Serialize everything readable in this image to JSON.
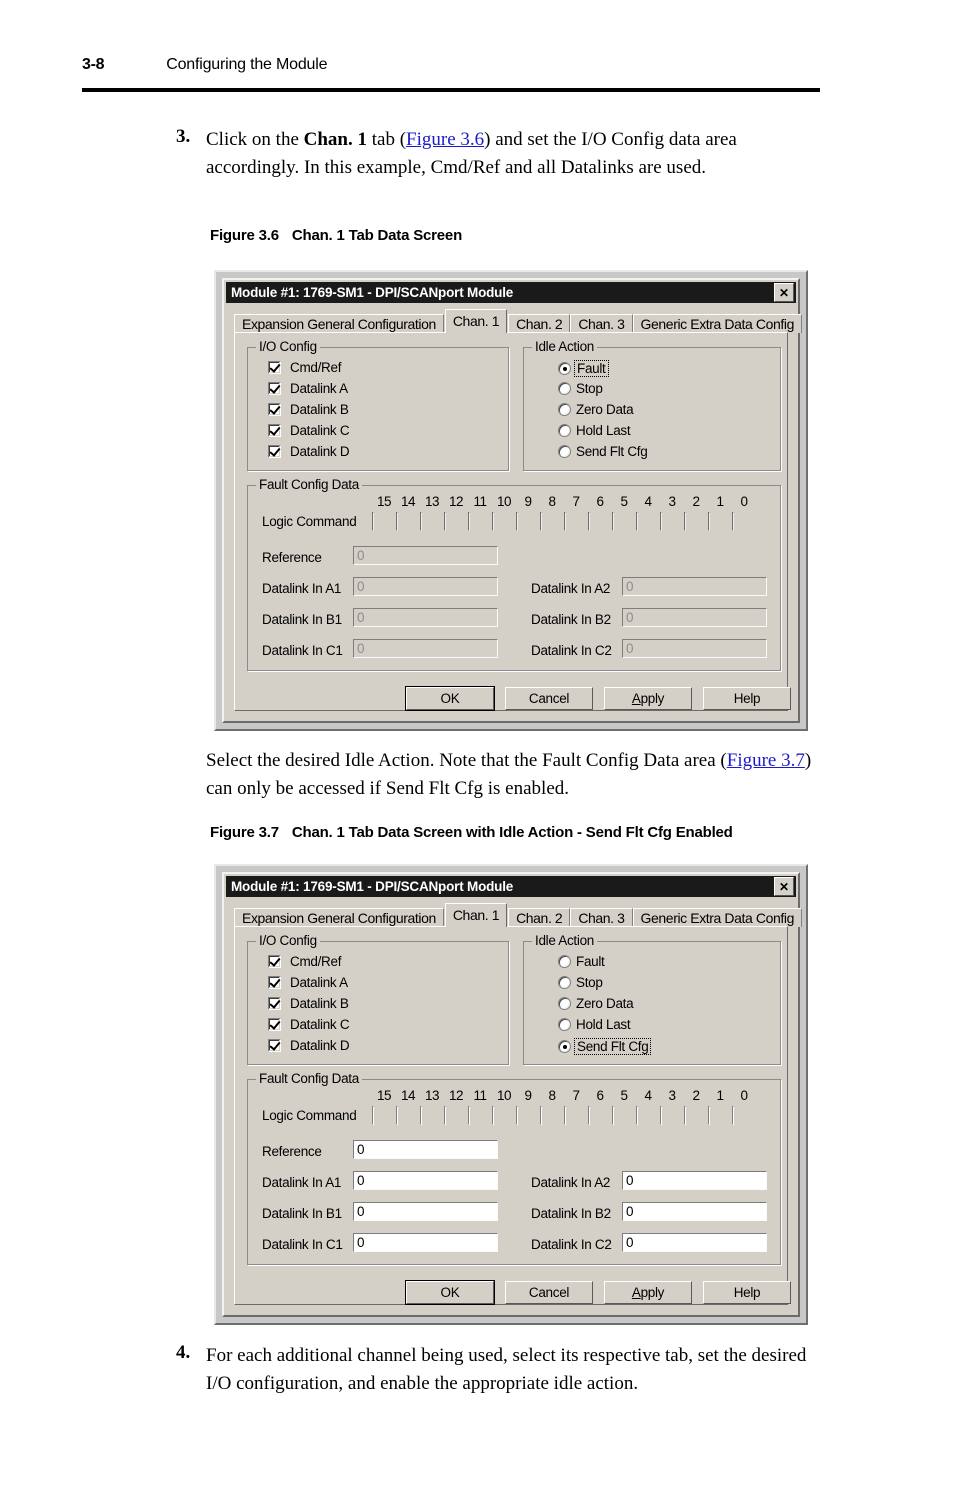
{
  "page": {
    "number": "3-8",
    "running_head": "Configuring the Module"
  },
  "step3": {
    "num": "3.",
    "text_a": "Click on the ",
    "bold_a": "Chan. 1",
    "text_b": " tab (",
    "link": "Figure 3.6",
    "text_c": ") and set the I/O Config data area accordingly. In this example, Cmd/Ref and all Datalinks are used."
  },
  "figure36": {
    "label": "Figure 3.6",
    "caption": "Chan. 1 Tab Data Screen"
  },
  "midpara": {
    "text_a": "Select the desired Idle Action. Note that the Fault Config Data area (",
    "link": "Figure 3.7",
    "text_b": ") can only be accessed if Send Flt Cfg is enabled."
  },
  "figure37": {
    "label": "Figure 3.7",
    "caption": "Chan. 1 Tab Data Screen with Idle Action - Send Flt Cfg Enabled"
  },
  "step4": {
    "num": "4.",
    "text": "For each additional channel being used, select its respective tab, set the desired I/O configuration, and enable the appropriate idle action."
  },
  "dialog": {
    "title": "Module #1: 1769-SM1 - DPI/SCANport Module",
    "close_label": "✕",
    "tabs": [
      {
        "label": "Expansion General Configuration",
        "active": false
      },
      {
        "label": "Chan. 1",
        "active": true
      },
      {
        "label": "Chan. 2",
        "active": false
      },
      {
        "label": "Chan. 3",
        "active": false
      },
      {
        "label": "Generic Extra Data Config",
        "active": false
      }
    ],
    "io_config": {
      "title": "I/O Config",
      "items": [
        {
          "label": "Cmd/Ref",
          "checked": true
        },
        {
          "label": "Datalink A",
          "checked": true
        },
        {
          "label": "Datalink B",
          "checked": true
        },
        {
          "label": "Datalink C",
          "checked": true
        },
        {
          "label": "Datalink D",
          "checked": true
        }
      ]
    },
    "idle_action": {
      "title": "Idle Action",
      "options": [
        "Fault",
        "Stop",
        "Zero Data",
        "Hold Last",
        "Send Flt Cfg"
      ]
    },
    "fault_config": {
      "title": "Fault Config Data",
      "logic_command_label": "Logic Command",
      "bits": [
        "15",
        "14",
        "13",
        "12",
        "11",
        "10",
        "9",
        "8",
        "7",
        "6",
        "5",
        "4",
        "3",
        "2",
        "1",
        "0"
      ],
      "bit_values": [
        false,
        false,
        false,
        false,
        false,
        false,
        false,
        false,
        false,
        false,
        false,
        false,
        false,
        false,
        false,
        false
      ],
      "reference_label": "Reference",
      "reference_value": "0",
      "fields_left": [
        {
          "label": "Datalink In A1",
          "value": "0"
        },
        {
          "label": "Datalink In B1",
          "value": "0"
        },
        {
          "label": "Datalink In C1",
          "value": "0"
        }
      ],
      "fields_right": [
        {
          "label": "Datalink In A2",
          "value": "0"
        },
        {
          "label": "Datalink In B2",
          "value": "0"
        },
        {
          "label": "Datalink In C2",
          "value": "0"
        }
      ]
    },
    "buttons": [
      {
        "label": "OK",
        "default": true
      },
      {
        "label": "Cancel",
        "default": false
      },
      {
        "label": "Apply",
        "default": false,
        "accel": "A"
      },
      {
        "label": "Help",
        "default": false
      }
    ]
  },
  "states": {
    "fig36_selected_idle": "Fault",
    "fig36_fault_config_enabled": false,
    "fig37_selected_idle": "Send Flt Cfg",
    "fig37_fault_config_enabled": true
  },
  "colors": {
    "dialog_face": "#d4d0c8",
    "titlebar": "#1a1a1a",
    "link": "#1b1bcc",
    "page_bg": "#ffffff"
  }
}
